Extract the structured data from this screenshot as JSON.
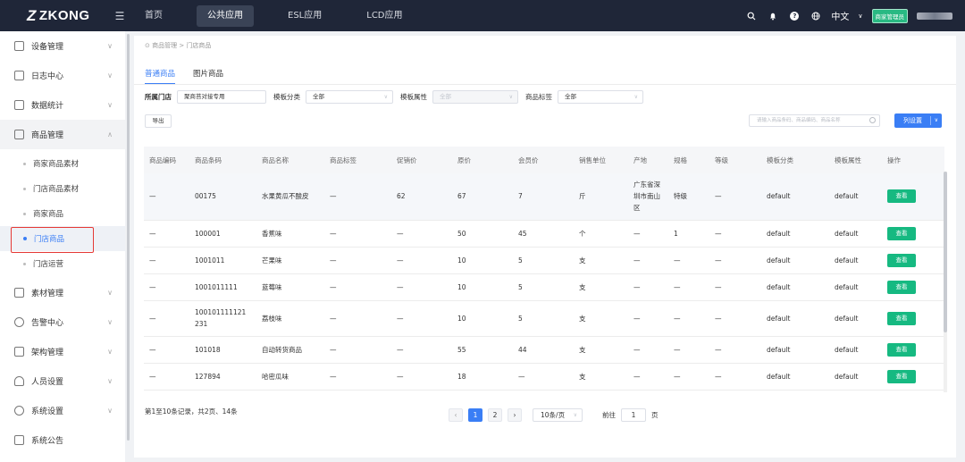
{
  "topbar": {
    "logo": "ZKONG",
    "nav": [
      "首页",
      "公共应用",
      "ESL应用",
      "LCD应用"
    ],
    "nav_active": 1,
    "language": "中文",
    "role": "商家管理员"
  },
  "sidebar": {
    "items": [
      {
        "label": "设备管理"
      },
      {
        "label": "日志中心"
      },
      {
        "label": "数据统计"
      },
      {
        "label": "商品管理"
      },
      {
        "label": "素材管理"
      },
      {
        "label": "告警中心"
      },
      {
        "label": "架构管理"
      },
      {
        "label": "人员设置"
      },
      {
        "label": "系统设置"
      },
      {
        "label": "系统公告"
      }
    ],
    "sub_items": [
      {
        "label": "商家商品素材"
      },
      {
        "label": "门店商品素材"
      },
      {
        "label": "商家商品"
      },
      {
        "label": "门店商品"
      },
      {
        "label": "门店运营"
      }
    ]
  },
  "breadcrumb": "商品管理 > 门店商品",
  "tabs": [
    "普通商品",
    "图片商品"
  ],
  "filters": {
    "store_label": "所属门店",
    "store_value": "聚商苔对接专用",
    "category_label": "模板分类",
    "category_value": "全部",
    "attr_label": "模板属性",
    "attr_value": "全部",
    "tag_label": "商品标签",
    "tag_value": "全部"
  },
  "toolbar": {
    "export": "导出",
    "search_placeholder": "请输入商品条码、商品编码、商品名称",
    "column_settings": "列设置"
  },
  "table": {
    "headers": [
      "商品编码",
      "商品条码",
      "商品名称",
      "商品标签",
      "促销价",
      "原价",
      "会员价",
      "销售单位",
      "产地",
      "规格",
      "等级",
      "模板分类",
      "模板属性",
      "操作"
    ],
    "rows": [
      [
        "—",
        "00175",
        "水果黄瓜不酸皮",
        "—",
        "62",
        "67",
        "7",
        "斤",
        "广东省深圳市南山区",
        "特级",
        "—",
        "default",
        "default",
        "查看"
      ],
      [
        "—",
        "100001",
        "香蕉味",
        "—",
        "—",
        "50",
        "45",
        "个",
        "—",
        "1",
        "—",
        "default",
        "default",
        "查看"
      ],
      [
        "—",
        "1001011",
        "芒果味",
        "—",
        "—",
        "10",
        "5",
        "支",
        "—",
        "—",
        "—",
        "default",
        "default",
        "查看"
      ],
      [
        "—",
        "1001011111",
        "蓝莓味",
        "—",
        "—",
        "10",
        "5",
        "支",
        "—",
        "—",
        "—",
        "default",
        "default",
        "查看"
      ],
      [
        "—",
        "100101111121231",
        "荔枝味",
        "—",
        "—",
        "10",
        "5",
        "支",
        "—",
        "—",
        "—",
        "default",
        "default",
        "查看"
      ],
      [
        "—",
        "101018",
        "自动转货商品",
        "—",
        "—",
        "55",
        "44",
        "支",
        "—",
        "—",
        "—",
        "default",
        "default",
        "查看"
      ],
      [
        "—",
        "127894",
        "哈密瓜味",
        "—",
        "—",
        "18",
        "—",
        "支",
        "—",
        "—",
        "—",
        "default",
        "default",
        "查看"
      ]
    ]
  },
  "footer": {
    "summary": "第1至10条记录，共2页、14条",
    "pages": [
      "1",
      "2"
    ],
    "page_size": "10条/页",
    "goto_label": "前往",
    "goto_value": "1",
    "goto_unit": "页"
  }
}
